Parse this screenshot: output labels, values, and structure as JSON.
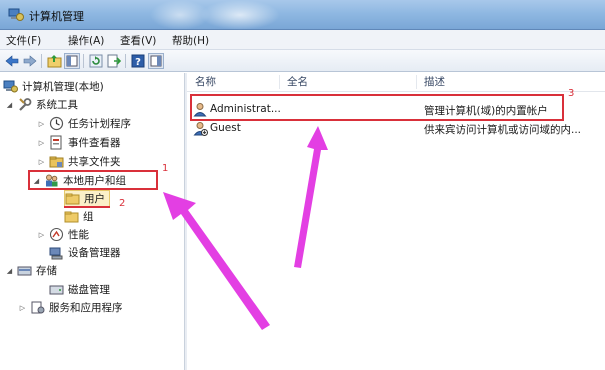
{
  "window": {
    "title": "计算机管理"
  },
  "menu": [
    "文件(F)",
    "操作(A)",
    "查看(V)",
    "帮助(H)"
  ],
  "toolbar": [
    "back-icon",
    "forward-icon",
    "up-folder-icon",
    "show-tree-icon",
    "refresh-icon",
    "export-icon",
    "help-icon",
    "properties-icon"
  ],
  "tree": [
    {
      "label": "计算机管理(本地)",
      "icon": "computer-management-icon"
    },
    {
      "label": "系统工具",
      "icon": "tools-icon",
      "expanded": true
    },
    {
      "label": "任务计划程序",
      "icon": "clock-icon"
    },
    {
      "label": "事件查看器",
      "icon": "event-viewer-icon"
    },
    {
      "label": "共享文件夹",
      "icon": "shared-folder-icon"
    },
    {
      "label": "本地用户和组",
      "icon": "users-groups-icon",
      "expanded": true
    },
    {
      "label": "用户",
      "icon": "folder-icon",
      "selected": true
    },
    {
      "label": "组",
      "icon": "folder-icon"
    },
    {
      "label": "性能",
      "icon": "performance-icon"
    },
    {
      "label": "设备管理器",
      "icon": "device-manager-icon"
    },
    {
      "label": "存储",
      "icon": "storage-icon",
      "expanded": true
    },
    {
      "label": "磁盘管理",
      "icon": "disk-icon"
    },
    {
      "label": "服务和应用程序",
      "icon": "services-icon"
    }
  ],
  "columns": {
    "name": "名称",
    "fullname": "全名",
    "description": "描述"
  },
  "users": [
    {
      "name": "Administrat...",
      "fullname": "",
      "description": "管理计算机(域)的内置帐户",
      "highlighted": true
    },
    {
      "name": "Guest",
      "fullname": "",
      "description": "供来宾访问计算机或访问域的内..."
    }
  ],
  "annotations": {
    "n1": "1",
    "n2": "2",
    "n3": "3"
  },
  "colors": {
    "annotation": "#d9303a",
    "arrow": "#e33fe3"
  }
}
